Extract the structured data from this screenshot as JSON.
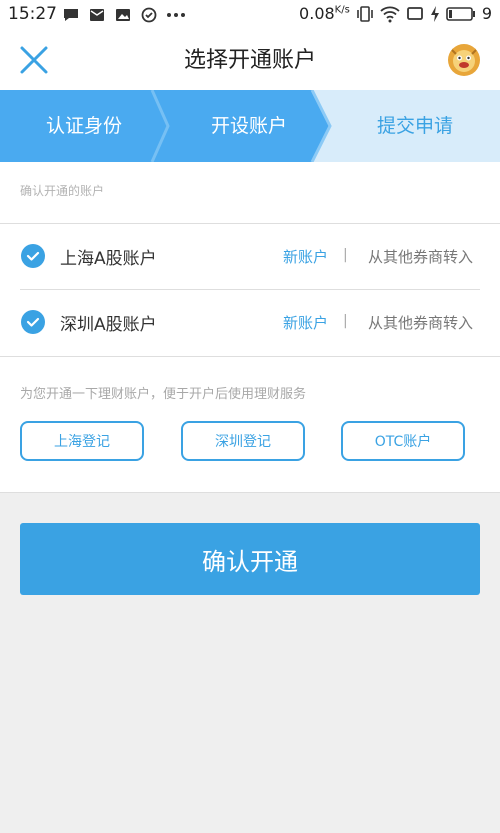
{
  "status_bar": {
    "time": "15:27",
    "network_speed": "0.08",
    "speed_unit": "K/s",
    "battery_level": "9",
    "left_icons": [
      "chat-icon",
      "mail-icon",
      "image-icon",
      "check-circle-icon",
      "more-dots-icon"
    ],
    "right_icons": [
      "vibrate-icon",
      "wifi-icon",
      "screen-icon",
      "charging-icon",
      "battery-icon"
    ]
  },
  "nav": {
    "title": "选择开通账户",
    "close_icon": "close-icon",
    "mascot_icon": "lion-mascot-icon"
  },
  "stepper": {
    "steps": [
      "认证身份",
      "开设账户",
      "提交申请"
    ],
    "active_index": 1,
    "colors": {
      "done": "#4aaaf0",
      "active": "#4aaaf0",
      "pending": "#d8ecfa",
      "done_text": "#ffffff",
      "pending_text": "#3aa2e3"
    }
  },
  "accounts": {
    "hint": "确认开通的账户",
    "rows": [
      {
        "name": "上海A股账户",
        "new_label": "新账户",
        "separator": "|",
        "transfer_label": "从其他券商转入",
        "checked": true
      },
      {
        "name": "深圳A股账户",
        "new_label": "新账户",
        "separator": "|",
        "transfer_label": "从其他券商转入",
        "checked": true
      }
    ]
  },
  "finance": {
    "hint": "为您开通一下理财账户，便于开户后使用理财服务",
    "buttons": [
      "上海登记",
      "深圳登记",
      "OTC账户"
    ]
  },
  "confirm": {
    "label": "确认开通"
  },
  "colors": {
    "accent": "#3aa2e3",
    "background": "#efefef",
    "card": "#ffffff"
  }
}
